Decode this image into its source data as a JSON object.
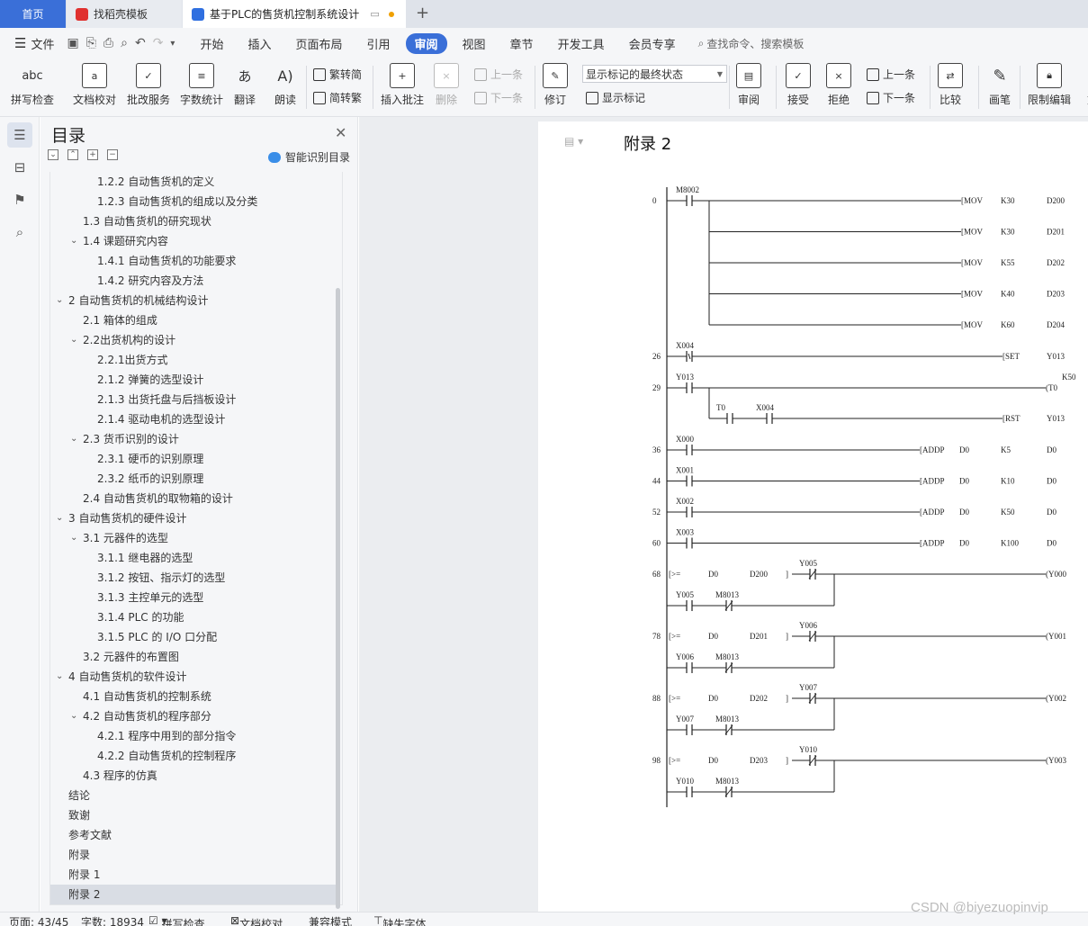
{
  "tabs": {
    "home": "首页",
    "template": "找稻壳模板",
    "document": "基于PLC的售货机控制系统设计"
  },
  "menu": {
    "file": "文件",
    "items": [
      "开始",
      "插入",
      "页面布局",
      "引用",
      "审阅",
      "视图",
      "章节",
      "开发工具",
      "会员专享"
    ],
    "active": "审阅",
    "search": "查找命令、搜索模板"
  },
  "ribbon": {
    "spell_check": "拼写检查",
    "doc_proof": "文档校对",
    "revise_service": "批改服务",
    "word_count": "字数统计",
    "translate": "翻译",
    "read_aloud": "朗读",
    "trad_to_simp": "繁转简",
    "simp_to_trad": "简转繁",
    "insert_comment": "插入批注",
    "delete": "删除",
    "prev_comment": "上一条",
    "next_comment": "下一条",
    "track": "修订",
    "display_state": "显示标记的最终状态",
    "show_markup": "显示标记",
    "review": "审阅",
    "accept": "接受",
    "reject": "拒绝",
    "prev_change": "上一条",
    "next_change": "下一条",
    "compare": "比较",
    "pen": "画笔",
    "restrict": "限制编辑",
    "doc_cut": "文"
  },
  "toc": {
    "title": "目录",
    "smart": "智能识别目录",
    "items": [
      {
        "label": "1.2.2 自动售货机的定义",
        "level": 3
      },
      {
        "label": "1.2.3 自动售货机的组成以及分类",
        "level": 3
      },
      {
        "label": "1.3 自动售货机的研究现状",
        "level": 2
      },
      {
        "label": "1.4 课题研究内容",
        "level": 2,
        "expand": true
      },
      {
        "label": "1.4.1  自动售货机的功能要求",
        "level": 3
      },
      {
        "label": "1.4.2 研究内容及方法",
        "level": 3
      },
      {
        "label": "2 自动售货机的机械结构设计",
        "level": 1,
        "expand": true
      },
      {
        "label": "2.1  箱体的组成",
        "level": 2
      },
      {
        "label": "2.2出货机构的设计",
        "level": 2,
        "expand": true
      },
      {
        "label": "2.2.1出货方式",
        "level": 3
      },
      {
        "label": "2.1.2 弹簧的选型设计",
        "level": 3
      },
      {
        "label": "2.1.3 出货托盘与后挡板设计",
        "level": 3
      },
      {
        "label": "2.1.4 驱动电机的选型设计",
        "level": 3
      },
      {
        "label": "2.3 货币识别的设计",
        "level": 2,
        "expand": true
      },
      {
        "label": "2.3.1  硬币的识别原理",
        "level": 3
      },
      {
        "label": "2.3.2  纸币的识别原理",
        "level": 3
      },
      {
        "label": "2.4 自动售货机的取物箱的设计",
        "level": 2
      },
      {
        "label": "3 自动售货机的硬件设计",
        "level": 1,
        "expand": true
      },
      {
        "label": "3.1 元器件的选型",
        "level": 2,
        "expand": true
      },
      {
        "label": "3.1.1 继电器的选型",
        "level": 3
      },
      {
        "label": "3.1.2 按钮、指示灯的选型",
        "level": 3
      },
      {
        "label": "3.1.3 主控单元的选型",
        "level": 3
      },
      {
        "label": "3.1.4 PLC 的功能",
        "level": 3
      },
      {
        "label": "3.1.5 PLC 的 I/O 口分配",
        "level": 3
      },
      {
        "label": "3.2 元器件的布置图",
        "level": 2
      },
      {
        "label": "4  自动售货机的软件设计",
        "level": 1,
        "expand": true
      },
      {
        "label": "4.1  自动售货机的控制系统",
        "level": 2
      },
      {
        "label": "4.2  自动售货机的程序部分",
        "level": 2,
        "expand": true
      },
      {
        "label": "4.2.1  程序中用到的部分指令",
        "level": 3
      },
      {
        "label": "4.2.2  自动售货机的控制程序",
        "level": 3
      },
      {
        "label": "4.3  程序的仿真",
        "level": 2
      },
      {
        "label": "结论",
        "level": 1
      },
      {
        "label": "致谢",
        "level": 1
      },
      {
        "label": "参考文献",
        "level": 1
      },
      {
        "label": "附录",
        "level": 1
      },
      {
        "label": "附录 1",
        "level": 1
      },
      {
        "label": "附录 2",
        "level": 1,
        "selected": true
      }
    ]
  },
  "page": {
    "heading": "附录 2"
  },
  "ladder": {
    "rungs": [
      {
        "step": "0",
        "contact": "M8002",
        "coils": [
          [
            "MOV",
            "K30",
            "D200"
          ],
          [
            "MOV",
            "K30",
            "D201"
          ],
          [
            "MOV",
            "K55",
            "D202"
          ],
          [
            "MOV",
            "K40",
            "D203"
          ],
          [
            "MOV",
            "K60",
            "D204"
          ]
        ]
      },
      {
        "step": "26",
        "contact": "X004",
        "coil": [
          "SET",
          "",
          "Y013"
        ]
      },
      {
        "step": "29",
        "contact": "Y013",
        "coil": [
          "T0",
          "K50",
          ""
        ],
        "branch": [
          "T0",
          "X004"
        ],
        "branch_coil": [
          "RST",
          "",
          "Y013"
        ]
      },
      {
        "step": "36",
        "contact": "X000",
        "coil": [
          "ADDP",
          "D0",
          "K5",
          "D0"
        ]
      },
      {
        "step": "44",
        "contact": "X001",
        "coil": [
          "ADDP",
          "D0",
          "K10",
          "D0"
        ]
      },
      {
        "step": "52",
        "contact": "X002",
        "coil": [
          "ADDP",
          "D0",
          "K50",
          "D0"
        ]
      },
      {
        "step": "60",
        "contact": "X003",
        "coil": [
          "ADDP",
          "D0",
          "K100",
          "D0"
        ]
      },
      {
        "step": "68",
        "cmp": [
          "D0",
          "D200"
        ],
        "nc": "Y005",
        "out": "Y000",
        "branch": [
          "Y005",
          "M8013"
        ]
      },
      {
        "step": "78",
        "cmp": [
          "D0",
          "D201"
        ],
        "nc": "Y006",
        "out": "Y001",
        "branch": [
          "Y006",
          "M8013"
        ]
      },
      {
        "step": "88",
        "cmp": [
          "D0",
          "D202"
        ],
        "nc": "Y007",
        "out": "Y002",
        "branch": [
          "Y007",
          "M8013"
        ]
      },
      {
        "step": "98",
        "cmp": [
          "D0",
          "D203"
        ],
        "nc": "Y010",
        "out": "Y003",
        "branch": [
          "Y010",
          "M8013"
        ]
      }
    ],
    "cmp_op": ">="
  },
  "status": {
    "page": "页面: 43/45",
    "words": "字数: 18934",
    "spell": "拼写检查",
    "proof": "文档校对",
    "compat": "兼容模式",
    "font": "缺失字体"
  },
  "watermark": "CSDN @biyezuopinvip"
}
